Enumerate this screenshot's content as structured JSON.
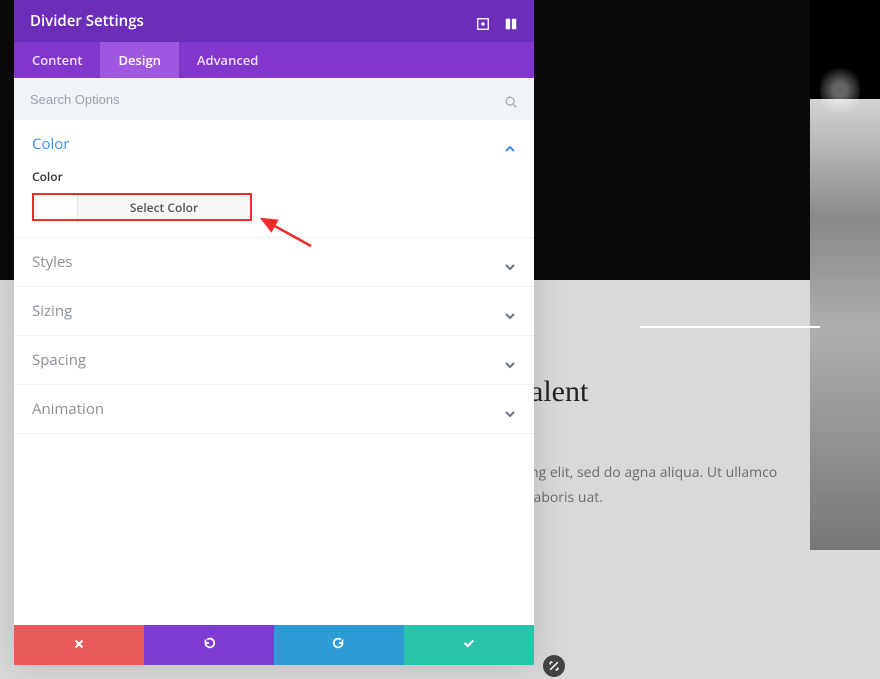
{
  "page": {
    "heading_fragment": "alent",
    "body_text": "ng elit, sed do agna aliqua. Ut ullamco laboris uat."
  },
  "panel": {
    "title": "Divider Settings",
    "tabs": {
      "content": "Content",
      "design": "Design",
      "advanced": "Advanced",
      "active": "design"
    },
    "search_placeholder": "Search Options",
    "sections": {
      "color": {
        "title": "Color",
        "field_label": "Color",
        "select_label": "Select Color"
      },
      "styles": {
        "title": "Styles"
      },
      "sizing": {
        "title": "Sizing"
      },
      "spacing": {
        "title": "Spacing"
      },
      "animation": {
        "title": "Animation"
      }
    }
  },
  "icons": {
    "fullscreen": "fullscreen-icon",
    "snap": "snap-icon",
    "search": "search-icon",
    "chevron_up": "chevron-up-icon",
    "chevron_down": "chevron-down-icon",
    "close": "close-icon",
    "undo": "undo-icon",
    "redo": "redo-icon",
    "check": "check-icon",
    "expand_handle": "expand-handle-icon"
  },
  "colors": {
    "header": "#6C2EB9",
    "tabbar": "#8336CC",
    "tab_active": "#A057E0",
    "link": "#3d8ef7",
    "annotation": "#ef2b2b",
    "footer_close": "#ea5a5a",
    "footer_undo": "#7e3bd0",
    "footer_redo": "#2c9bd6",
    "footer_confirm": "#29c4a9"
  }
}
